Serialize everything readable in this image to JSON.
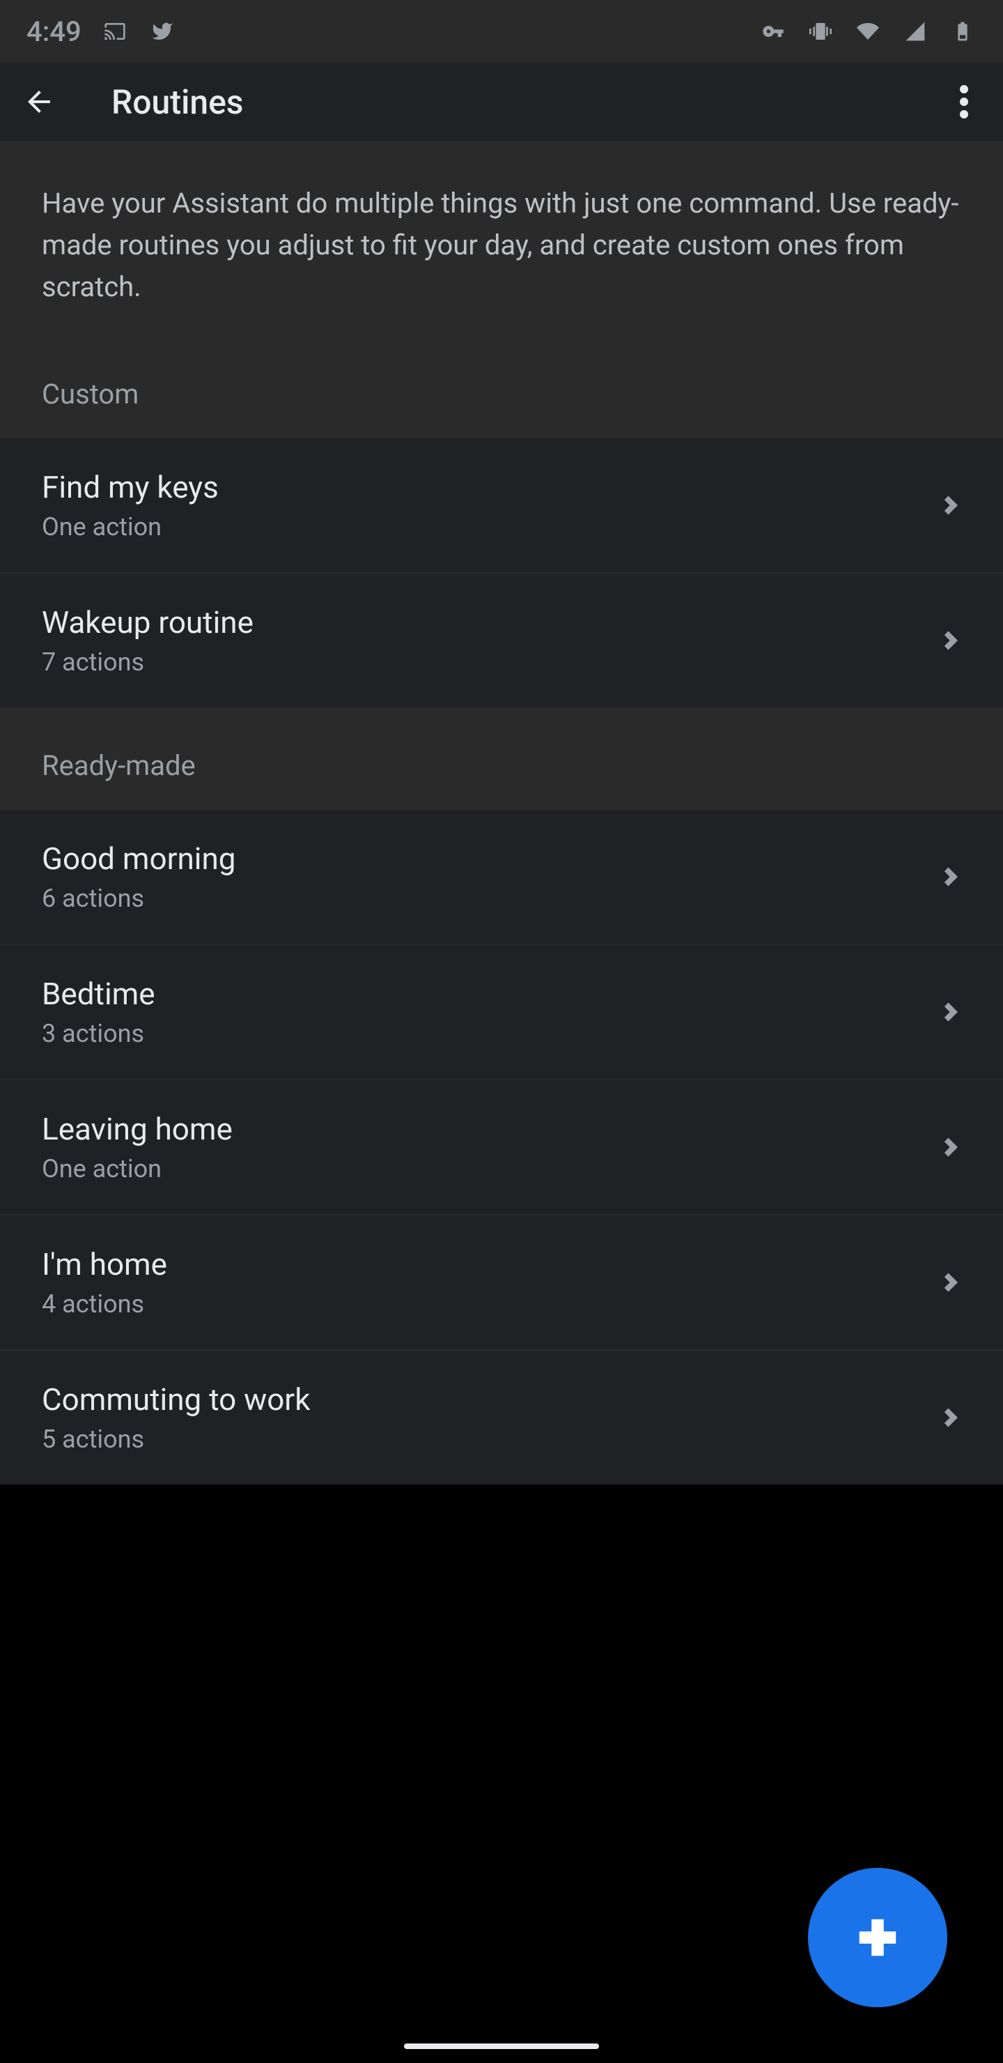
{
  "status": {
    "time": "4:49"
  },
  "header": {
    "title": "Routines"
  },
  "intro": "Have your Assistant do multiple things with just one command. Use ready-made routines you adjust to fit your day, and create custom ones from scratch.",
  "sections": {
    "custom": {
      "label": "Custom",
      "items": [
        {
          "title": "Find my keys",
          "sub": "One action"
        },
        {
          "title": "Wakeup routine",
          "sub": "7 actions"
        }
      ]
    },
    "ready": {
      "label": "Ready-made",
      "items": [
        {
          "title": "Good morning",
          "sub": "6 actions"
        },
        {
          "title": "Bedtime",
          "sub": "3 actions"
        },
        {
          "title": "Leaving home",
          "sub": "One action"
        },
        {
          "title": "I'm home",
          "sub": "4 actions"
        },
        {
          "title": "Commuting to work",
          "sub": "5 actions"
        }
      ]
    }
  }
}
